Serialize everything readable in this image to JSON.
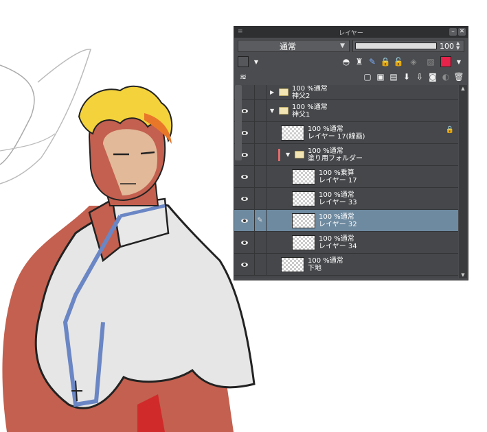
{
  "panel": {
    "title": "レイヤー",
    "blend_mode": "通常",
    "opacity": "100",
    "layers": [
      {
        "opacity_mode": "100 %通常",
        "name": "神父2",
        "kind": "folder",
        "expanded": false
      },
      {
        "opacity_mode": "100 %通常",
        "name": "神父1",
        "kind": "folder",
        "expanded": true
      },
      {
        "opacity_mode": "100 %通常",
        "name": "レイヤー 17(線画)",
        "kind": "layer"
      },
      {
        "opacity_mode": "100 %通常",
        "name": "塗り用フォルダー",
        "kind": "folder",
        "expanded": true
      },
      {
        "opacity_mode": "100 %乗算",
        "name": "レイヤー 17",
        "kind": "layer"
      },
      {
        "opacity_mode": "100 %通常",
        "name": "レイヤー 33",
        "kind": "layer"
      },
      {
        "opacity_mode": "100 %通常",
        "name": "レイヤー 32",
        "kind": "layer",
        "selected": true
      },
      {
        "opacity_mode": "100 %通常",
        "name": "レイヤー 34",
        "kind": "layer"
      },
      {
        "opacity_mode": "100 %通常",
        "name": "下地",
        "kind": "layer"
      }
    ],
    "selection_color": "#6e8aa0"
  }
}
